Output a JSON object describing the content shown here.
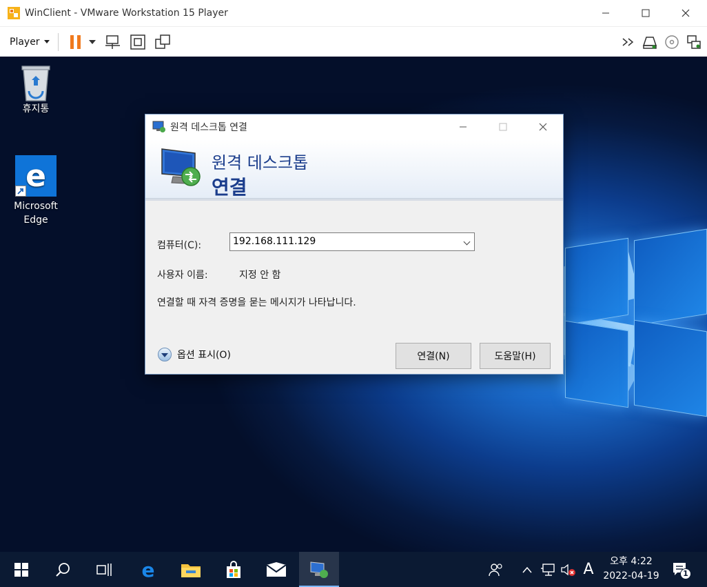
{
  "vm": {
    "title": "WinClient - VMware Workstation 15 Player",
    "player_menu": "Player",
    "icons": [
      "pause-icon",
      "dropdown-icon",
      "send-ctrl-alt-del-icon",
      "fit-guest-icon",
      "fullscreen-icon",
      "unity-icon",
      "more-icon",
      "removable-device-icon",
      "cd-icon",
      "network-adapter-icon"
    ]
  },
  "desktop": {
    "icons": [
      {
        "label": "휴지통"
      },
      {
        "label": "Microsoft Edge"
      }
    ]
  },
  "rdp": {
    "title": "원격 데스크톱 연결",
    "banner_line1": "원격 데스크톱",
    "banner_line2": "연결",
    "computer_label": "컴퓨터(C):",
    "computer_value": "192.168.111.129",
    "user_label": "사용자 이름:",
    "user_value": "지정 안 함",
    "notice": "연결할 때 자격 증명을 묻는 메시지가 나타납니다.",
    "options_label": "옵션 표시(O)",
    "connect_button": "연결(N)",
    "help_button": "도움말(H)"
  },
  "taskbar": {
    "clock_time": "오후 4:22",
    "clock_date": "2022-04-19",
    "ime": "A",
    "notification_count": "1"
  },
  "colors": {
    "taskbar": "#0b1a33",
    "rdp_banner_text": "#1b3d8c",
    "vm_pause": "#f07a1e"
  }
}
